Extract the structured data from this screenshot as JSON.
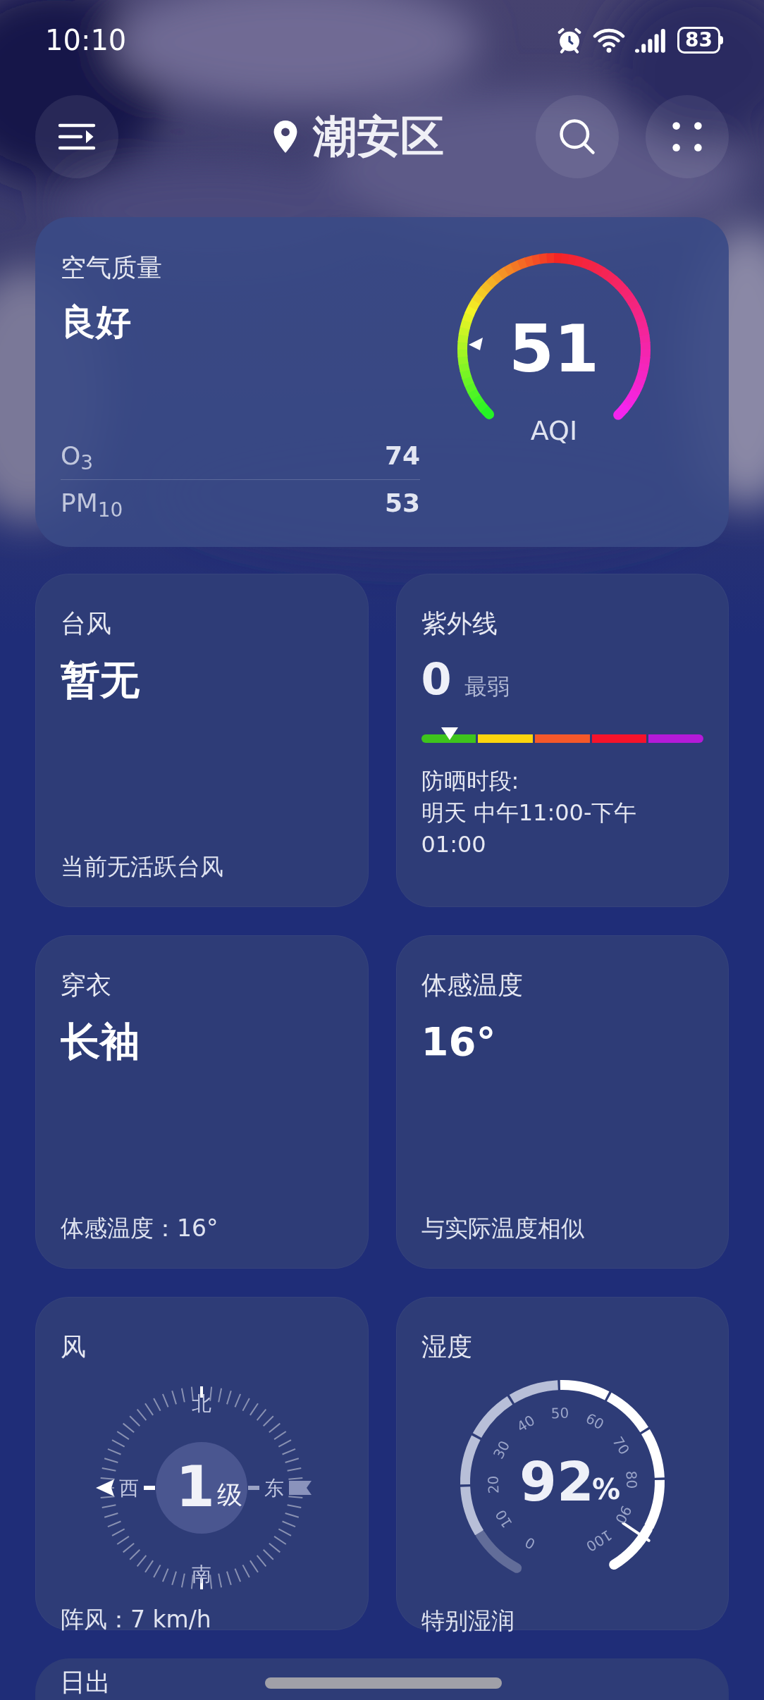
{
  "status_bar": {
    "time": "10:10",
    "battery": "83"
  },
  "header": {
    "location": "潮安区"
  },
  "air_quality": {
    "title": "空气质量",
    "status": "良好",
    "pollutants": [
      {
        "name": "O",
        "sub": "3",
        "value": "74"
      },
      {
        "name": "PM",
        "sub": "10",
        "value": "53"
      }
    ],
    "aqi": {
      "value": "51",
      "label": "AQI"
    }
  },
  "cards": [
    {
      "kind": "text",
      "title": "台风",
      "value": "暂无",
      "note": "当前无活跃台风"
    },
    {
      "kind": "uv",
      "title": "紫外线",
      "value": "0",
      "desc": "最弱",
      "protect_label": "防晒时段:",
      "protect_time": "明天 中午11:00-下午01:00"
    },
    {
      "kind": "text",
      "title": "穿衣",
      "value": "长袖",
      "note": "体感温度：16°"
    },
    {
      "kind": "text",
      "title": "体感温度",
      "value": "16°",
      "note": "与实际温度相似"
    },
    {
      "kind": "wind",
      "title": "风",
      "value": "1",
      "unit": "级",
      "directions": [
        "北",
        "东",
        "南",
        "西"
      ],
      "note": "阵风：7 km/h"
    },
    {
      "kind": "humidity",
      "title": "湿度",
      "value": "92",
      "unit": "%",
      "scale": [
        "0",
        "10",
        "20",
        "30",
        "40",
        "50",
        "60",
        "70",
        "80",
        "90",
        "100"
      ],
      "note": "特别湿润"
    }
  ],
  "next_card": {
    "title": "日出"
  }
}
